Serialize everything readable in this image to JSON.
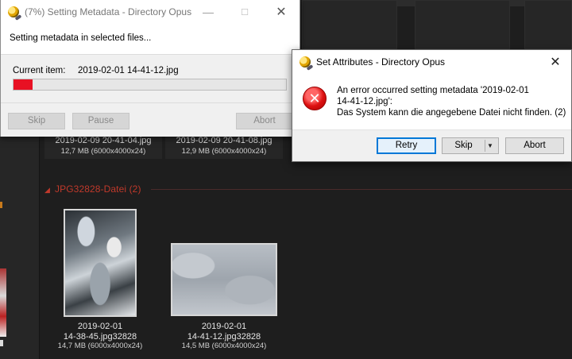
{
  "background": {
    "top_files": [
      {
        "name": "2019-02-09 20-41-04.jpg",
        "meta": "12,7 MB (6000x4000x24)"
      },
      {
        "name": "2019-02-09 20-41-08.jpg",
        "meta": "12,9 MB (6000x4000x24)"
      }
    ],
    "group": {
      "label": "JPG32828-Datei (2)"
    },
    "group_files": [
      {
        "line1": "2019-02-01",
        "line2": "14-38-45.jpg32828",
        "meta": "14,7 MB (6000x4000x24)"
      },
      {
        "line1": "2019-02-01",
        "line2": "14-41-12.jpg32828",
        "meta": "14,5 MB (6000x4000x24)"
      }
    ]
  },
  "progress_dialog": {
    "title": "(7%) Setting Metadata - Directory Opus",
    "message": "Setting metadata in selected files...",
    "current_item_label": "Current item:",
    "current_item_value": "2019-02-01 14-41-12.jpg",
    "progress_percent": 7,
    "progress_color": "#e81123",
    "buttons": {
      "skip": "Skip",
      "pause": "Pause",
      "abort": "Abort"
    },
    "controls": {
      "minimize": "—",
      "maximize": "☐",
      "close": "✕"
    }
  },
  "error_dialog": {
    "title": "Set Attributes - Directory Opus",
    "message_line1": "An error occurred setting metadata '2019-02-01",
    "message_line2": "14-41-12.jpg':",
    "message_line3": "Das System kann die angegebene Datei nicht finden. (2)",
    "buttons": {
      "retry": "Retry",
      "skip": "Skip",
      "abort": "Abort"
    },
    "controls": {
      "close": "✕"
    }
  },
  "icons": {
    "app": "directory-opus-icon",
    "error": "error-x-icon"
  }
}
